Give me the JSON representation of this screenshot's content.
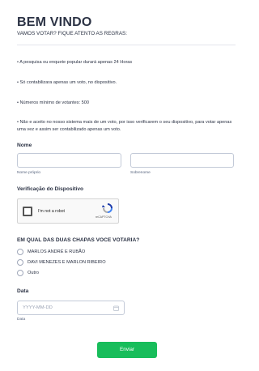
{
  "header": {
    "title": "BEM VINDO",
    "subtitle": "VAMOS VOTAR? FIQUE ATENTO AS REGRAS:"
  },
  "rules": [
    "• A pesquisa ou enquete popular durará apenas 24 Horas",
    "• Só contabilizara apenas um voto, no dispositivo.",
    "• Números mínimo de votantes: 500",
    "• Não e aceito no nosso sistema mais de um voto, por isso verificarem o seu dispositivo, para votar apenas uma vez e assim ser contabilizado apenas um voto."
  ],
  "name_field": {
    "label": "Nome",
    "first_sublabel": "Nome próprio",
    "last_sublabel": "Sobrenome",
    "first_value": "",
    "last_value": ""
  },
  "verification": {
    "label": "Verificação do Dispositivo",
    "captcha_text": "I'm not a robot",
    "captcha_brand": "reCAPTCHA"
  },
  "poll": {
    "question": "EM QUAL DAS DUAS CHAPAS VOCE VOTARIA?",
    "options": [
      "MARLOS ANDRÉ E RUBÃO",
      "DAVI MENEZES E MARLON RIBEIRO",
      "Outro"
    ]
  },
  "date_field": {
    "label": "Data",
    "placeholder": "YYYY-MM-DD",
    "sublabel": "Data",
    "icon": "calendar-icon"
  },
  "submit": {
    "label": "Enviar",
    "color": "#18bd5b"
  }
}
